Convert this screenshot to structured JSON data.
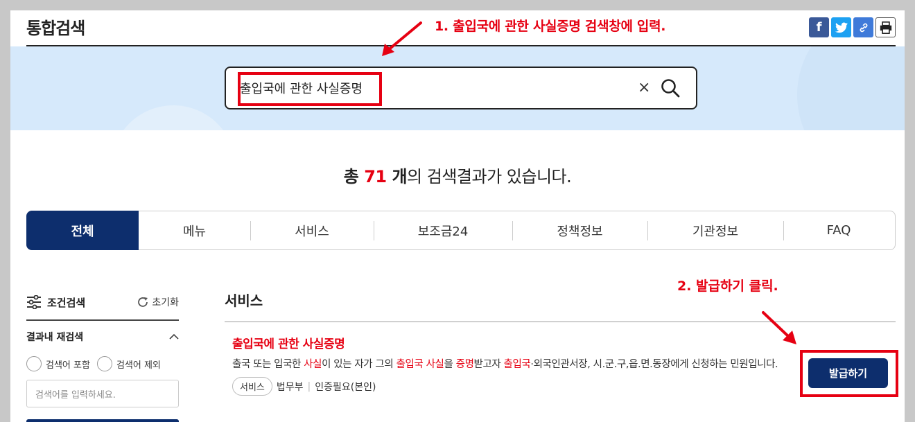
{
  "header": {
    "title": "통합검색",
    "share_icons": [
      "facebook-icon",
      "twitter-icon",
      "link-icon",
      "print-icon"
    ]
  },
  "annotations": {
    "step1": "1. 출입국에 관한 사실증명 검색창에 입력.",
    "step2": "2. 발급하기 클릭."
  },
  "search": {
    "value": "출입국에 관한 사실증명",
    "clear_label": "×"
  },
  "result_count": {
    "prefix": "총 ",
    "number": "71",
    "unit": " 개",
    "suffix": "의 검색결과가 있습니다."
  },
  "tabs": [
    {
      "label": "전체",
      "active": true
    },
    {
      "label": "메뉴"
    },
    {
      "label": "서비스"
    },
    {
      "label": "보조금24"
    },
    {
      "label": "정책정보"
    },
    {
      "label": "기관정보"
    },
    {
      "label": "FAQ"
    }
  ],
  "filter": {
    "title": "조건검색",
    "reset": "초기화",
    "re_search_label": "결과내 재검색",
    "include_label": "검색어 포함",
    "exclude_label": "검색어 제외",
    "placeholder": "검색어를 입력하세요."
  },
  "results": {
    "section_title": "서비스",
    "item": {
      "title": "출입국에 관한 사실증명",
      "desc_parts": [
        {
          "t": "출국 또는 입국한 ",
          "hl": false
        },
        {
          "t": "사실",
          "hl": true
        },
        {
          "t": "이 있는 자가 그의 ",
          "hl": false
        },
        {
          "t": "출입국",
          "hl": true
        },
        {
          "t": " ",
          "hl": false
        },
        {
          "t": "사실",
          "hl": true
        },
        {
          "t": "을 ",
          "hl": false
        },
        {
          "t": "증명",
          "hl": true
        },
        {
          "t": "받고자 ",
          "hl": false
        },
        {
          "t": "출입국",
          "hl": true
        },
        {
          "t": "·외국인관서장, 시.군.구,읍.면.동장에게 신청하는 민원입니다.",
          "hl": false
        }
      ],
      "tag": "서비스",
      "agency": "법무부",
      "auth": "인증필요(본인)",
      "button": "발급하기"
    }
  },
  "colors": {
    "navy": "#0d2e6d",
    "highlight_red": "#e60012",
    "band_blue": "#d6e9fb"
  }
}
